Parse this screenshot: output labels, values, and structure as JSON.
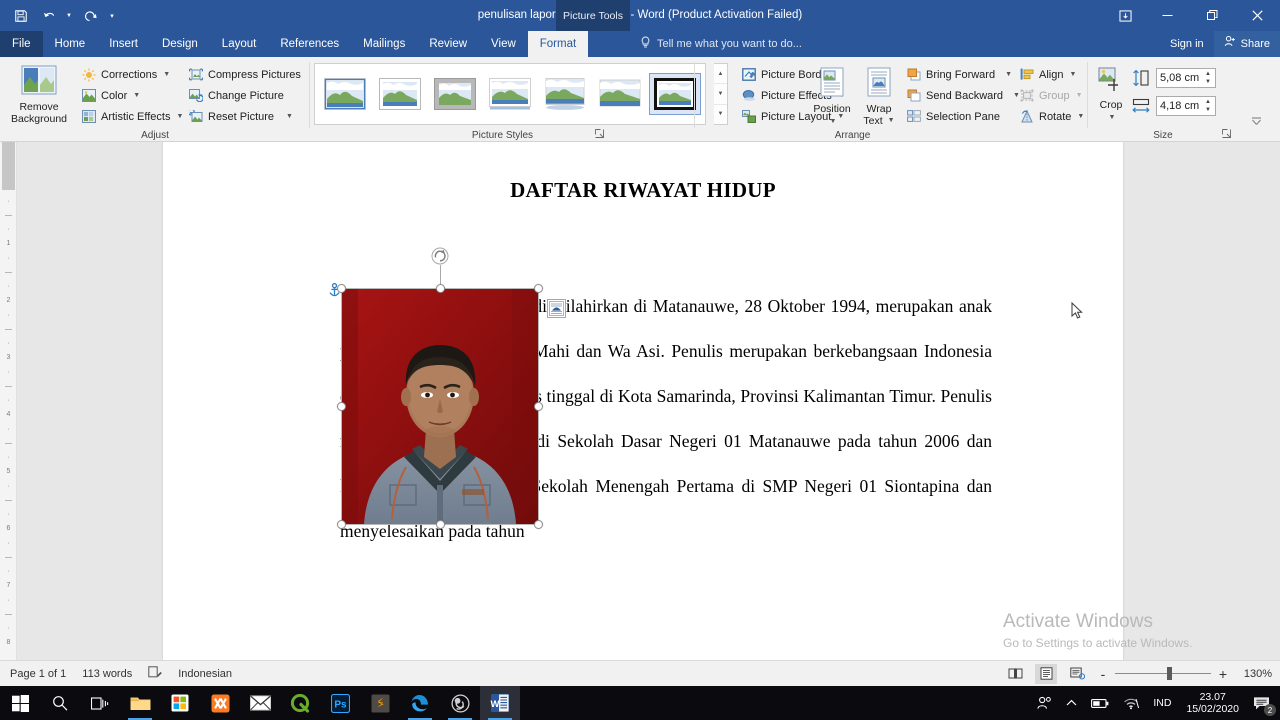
{
  "titlebar": {
    "document_title": "penulisan laporan kkp (kasdi) - Word (Product Activation Failed)",
    "contextual_tab_title": "Picture Tools",
    "qat": [
      {
        "name": "save",
        "label": "Save"
      },
      {
        "name": "undo",
        "label": "Undo"
      },
      {
        "name": "redo",
        "label": "Repeat"
      },
      {
        "name": "customize",
        "label": "Customize Quick Access Toolbar"
      }
    ],
    "window_controls": {
      "ribbon_display": "Ribbon Display Options",
      "minimize": "Minimize",
      "restore": "Restore Down",
      "close": "Close"
    }
  },
  "tabs": [
    {
      "label": "File",
      "active": false,
      "file": true
    },
    {
      "label": "Home",
      "active": false
    },
    {
      "label": "Insert",
      "active": false
    },
    {
      "label": "Design",
      "active": false
    },
    {
      "label": "Layout",
      "active": false
    },
    {
      "label": "References",
      "active": false
    },
    {
      "label": "Mailings",
      "active": false
    },
    {
      "label": "Review",
      "active": false
    },
    {
      "label": "View",
      "active": false
    },
    {
      "label": "Format",
      "active": true
    }
  ],
  "tellme": {
    "placeholder": "Tell me what you want to do..."
  },
  "account": {
    "signin": "Sign in",
    "share": "Share"
  },
  "ribbon": {
    "groups": [
      {
        "name": "adjust",
        "label": "Adjust"
      },
      {
        "name": "picture-styles",
        "label": "Picture Styles"
      },
      {
        "name": "arrange",
        "label": "Arrange"
      },
      {
        "name": "size",
        "label": "Size"
      }
    ],
    "adjust": {
      "remove_background": "Remove\nBackground",
      "remove_background_line1": "Remove",
      "remove_background_line2": "Background",
      "items": [
        {
          "label": "Corrections",
          "dropdown": true
        },
        {
          "label": "Color",
          "dropdown": true
        },
        {
          "label": "Artistic Effects",
          "dropdown": true
        },
        {
          "label": "Compress Pictures",
          "dropdown": false
        },
        {
          "label": "Change Picture",
          "dropdown": false
        },
        {
          "label": "Reset Picture",
          "dropdown": true
        }
      ]
    },
    "picture_styles": {
      "gallery_count": 7,
      "selected_index": 6,
      "side_items": [
        {
          "label": "Picture Border",
          "dropdown": true
        },
        {
          "label": "Picture Effects",
          "dropdown": true
        },
        {
          "label": "Picture Layout",
          "dropdown": true
        }
      ]
    },
    "arrange": {
      "position": "Position",
      "wrap_text_line1": "Wrap",
      "wrap_text_line2": "Text",
      "items": [
        {
          "label": "Bring Forward",
          "dropdown": true,
          "disabled": false
        },
        {
          "label": "Send Backward",
          "dropdown": true,
          "disabled": false
        },
        {
          "label": "Selection Pane",
          "dropdown": false,
          "disabled": false
        },
        {
          "label": "Align",
          "dropdown": true,
          "disabled": false
        },
        {
          "label": "Group",
          "dropdown": true,
          "disabled": true
        },
        {
          "label": "Rotate",
          "dropdown": true,
          "disabled": false
        }
      ]
    },
    "size": {
      "crop": "Crop",
      "shape_height": "5,08 cm",
      "shape_width": "4,18 cm"
    }
  },
  "document": {
    "title": "DAFTAR RIWAYAT HIDUP",
    "paragraph": "ma lengkap penulis Kasdi, dilahirkan di Matanauwe, 28 Oktober 1994, merupakan anak pertama dari pasangan La Mahi dan Wa Asi. Penulis merupakan berkebangsaan Indonesia dan beragama Islam. Penulis tinggal di Kota Samarinda, Provinsi Kalimantan Timur. Penulis menyelesaikan pendidikan di Sekolah Dasar Negeri 01 Matanauwe pada tahun 2006 dan kemudian melanjutkan di Sekolah Menengah Pertama di SMP Negeri 01 Siontapina dan menyelesaikan pada tahun",
    "picture": {
      "name": "photo-kasdi",
      "selected": true,
      "layout_options_label": "Layout Options"
    }
  },
  "watermark": {
    "line1": "Activate Windows",
    "line2": "Go to Settings to activate Windows."
  },
  "statusbar": {
    "page": "Page 1 of 1",
    "words": "113 words",
    "proofing": "Proofing errors",
    "language": "Indonesian",
    "views": [
      {
        "name": "read-mode",
        "label": "Read Mode",
        "active": false
      },
      {
        "name": "print-layout",
        "label": "Print Layout",
        "active": true
      },
      {
        "name": "web-layout",
        "label": "Web Layout",
        "active": false
      }
    ],
    "zoom_out": "-",
    "zoom_in": "+",
    "zoom_level": "130%"
  },
  "taskbar": {
    "icons": [
      {
        "name": "start",
        "label": "Start",
        "running": false
      },
      {
        "name": "search",
        "label": "Search",
        "running": false
      },
      {
        "name": "task-view",
        "label": "Task View",
        "running": false
      },
      {
        "name": "file-explorer",
        "label": "File Explorer",
        "running": true
      },
      {
        "name": "microsoft-store",
        "label": "Microsoft Store",
        "running": false
      },
      {
        "name": "xampp",
        "label": "XAMPP",
        "running": false
      },
      {
        "name": "mail",
        "label": "Mail",
        "running": false
      },
      {
        "name": "quran-app",
        "label": "Q",
        "running": false
      },
      {
        "name": "photoshop",
        "label": "Adobe Photoshop",
        "running": false
      },
      {
        "name": "sublime-text",
        "label": "Sublime Text",
        "running": false
      },
      {
        "name": "microsoft-edge",
        "label": "Microsoft Edge",
        "running": true
      },
      {
        "name": "obs-studio",
        "label": "OBS Studio",
        "running": true
      },
      {
        "name": "word",
        "label": "Microsoft Word",
        "running": true,
        "active": true
      }
    ],
    "tray": {
      "people": "People",
      "show_hidden": "Show hidden icons",
      "battery": "Battery",
      "network": "Network",
      "language": "IND",
      "time": "23.07",
      "date": "15/02/2020",
      "notifications_count": "2"
    }
  },
  "colors": {
    "word_blue": "#2b579a",
    "word_blue_dark": "#1f3f6e",
    "ribbon_bg": "#f1f1f1",
    "doc_bg": "#e7e7e7",
    "taskbar": "#0a0a0f",
    "accent": "#4aa3e8"
  }
}
